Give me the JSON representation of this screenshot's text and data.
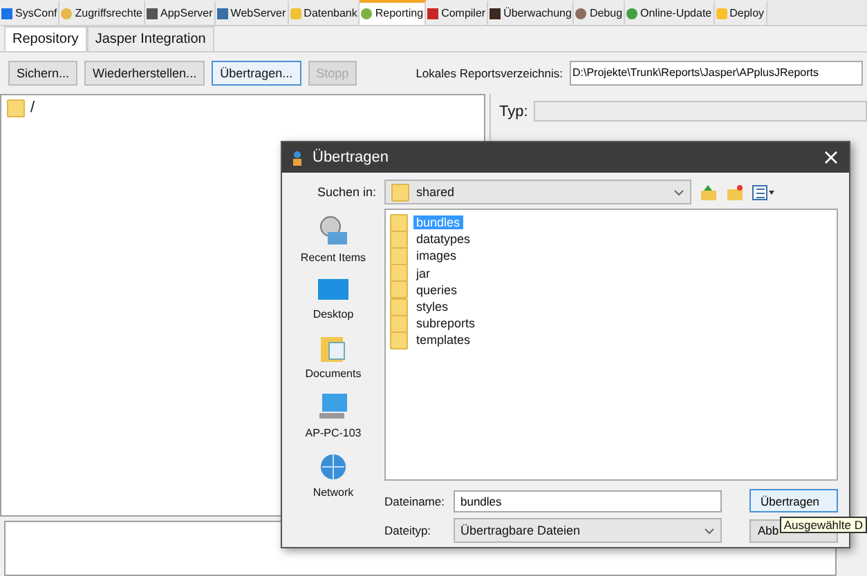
{
  "main_tabs": [
    {
      "label": "SysConf",
      "selected": false
    },
    {
      "label": "Zugriffsrechte",
      "selected": false
    },
    {
      "label": "AppServer",
      "selected": false
    },
    {
      "label": "WebServer",
      "selected": false
    },
    {
      "label": "Datenbank",
      "selected": false
    },
    {
      "label": "Reporting",
      "selected": true
    },
    {
      "label": "Compiler",
      "selected": false
    },
    {
      "label": "Überwachung",
      "selected": false
    },
    {
      "label": "Debug",
      "selected": false
    },
    {
      "label": "Online-Update",
      "selected": false
    },
    {
      "label": "Deploy",
      "selected": false
    }
  ],
  "sub_tabs": [
    {
      "label": "Repository",
      "selected": true
    },
    {
      "label": "Jasper Integration",
      "selected": false
    }
  ],
  "toolbar": {
    "buttons": [
      {
        "label": "Sichern...",
        "disabled": false,
        "focused": false
      },
      {
        "label": "Wiederherstellen...",
        "disabled": false,
        "focused": false
      },
      {
        "label": "Übertragen...",
        "disabled": false,
        "focused": true
      },
      {
        "label": "Stopp",
        "disabled": true,
        "focused": false
      }
    ],
    "directory_label": "Lokales Reportsverzeichnis:",
    "directory_value": "D:\\Projekte\\Trunk\\Reports\\Jasper\\APplusJReports"
  },
  "tree": {
    "items": [
      {
        "label": "/"
      }
    ]
  },
  "details": {
    "type_label": "Typ:"
  },
  "dialog": {
    "title": "Übertragen",
    "look_in_label": "Suchen in:",
    "look_in_value": "shared",
    "places": [
      {
        "label": "Recent Items",
        "kind": "recent"
      },
      {
        "label": "Desktop",
        "kind": "desktop"
      },
      {
        "label": "Documents",
        "kind": "documents"
      },
      {
        "label": "AP-PC-103",
        "kind": "computer"
      },
      {
        "label": "Network",
        "kind": "network"
      }
    ],
    "files": [
      {
        "name": "bundles",
        "selected": true
      },
      {
        "name": "datatypes",
        "selected": false
      },
      {
        "name": "images",
        "selected": false
      },
      {
        "name": "jar",
        "selected": false
      },
      {
        "name": "queries",
        "selected": false
      },
      {
        "name": "styles",
        "selected": false
      },
      {
        "name": "subreports",
        "selected": false
      },
      {
        "name": "templates",
        "selected": false
      }
    ],
    "filename_label": "Dateiname:",
    "filename_value": "bundles",
    "filetype_label": "Dateityp:",
    "filetype_value": "Übertragbare Dateien",
    "buttons": [
      "Übertragen",
      "Abb"
    ],
    "tooltip": "Ausgewählte D"
  }
}
